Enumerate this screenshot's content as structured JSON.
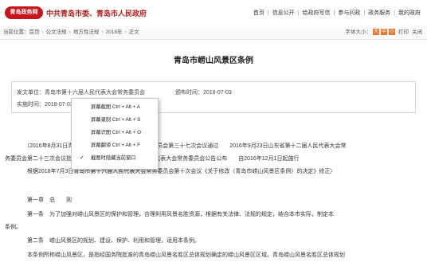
{
  "header": {
    "logo_text": "青岛政务网",
    "site_title": "中共青岛市委、青岛市人民政府",
    "nav": [
      "首页",
      "信息公开",
      "给政府写信",
      "参与问政",
      "政务服务",
      "我的政府"
    ]
  },
  "breadcrumb": {
    "prefix": "当前位置：",
    "items": [
      "首页",
      "公文法规",
      "地方性法规",
      "2018年",
      "正文"
    ]
  },
  "tools": {
    "font_size_label": "字体大小：",
    "sizes": [
      "大",
      "中",
      "小"
    ],
    "print": "打印",
    "close": "关闭"
  },
  "doc": {
    "title": "青岛市崂山风景区条例",
    "issuer": "发文单位：青岛市第十六届人民代表大会常务委员会",
    "publish_date": "颁布时间：2018-07-03",
    "effective_date": "实施时间：2018-07-03",
    "paragraphs": [
      "（2016年8月31日青岛市第十五届人民代表大会常务委员会第三十七次会议通过　　2016年9月23日山东省第十二届人民代表大会常",
      "务委员会第二十三次会议批准　　2016年9月26日青岛市人民代表大会常务委员会公告公布　　自2016年12月1日起施行",
      "根据2018年7月3日青岛市第十六届人民代表大会常务委员会第十次会议《关于修改〈青岛市崂山风景区条例〉的决定》修正）",
      "第一章　总　　则",
      "第一条　为了加强对崂山风景区的保护和管理，合理利用风景名胜资源，根据有关法律、法规的规定，结合本市实际，制定本",
      "条例。",
      "第二条　崂山风景区的规划、建设、保护、利用和管理，适用本条例。",
      "本条例所称崂山风景区，是指经国务院批准的青岛崂山风景名胜区总体规划确定的崂山风景区区域。青岛崂山风景名胜区总体规划"
    ]
  },
  "context_menu": {
    "items": [
      {
        "label": "屏幕截图 Ctrl + Alt + A",
        "checked": false
      },
      {
        "label": "屏幕录制 Ctrl + Alt + S",
        "checked": false
      },
      {
        "label": "屏幕识图 Ctrl + Alt + O",
        "checked": false
      },
      {
        "label": "屏幕翻译 Ctrl + Alt + F",
        "checked": false
      },
      {
        "label": "截图时隐藏当前窗口",
        "checked": true
      }
    ]
  }
}
